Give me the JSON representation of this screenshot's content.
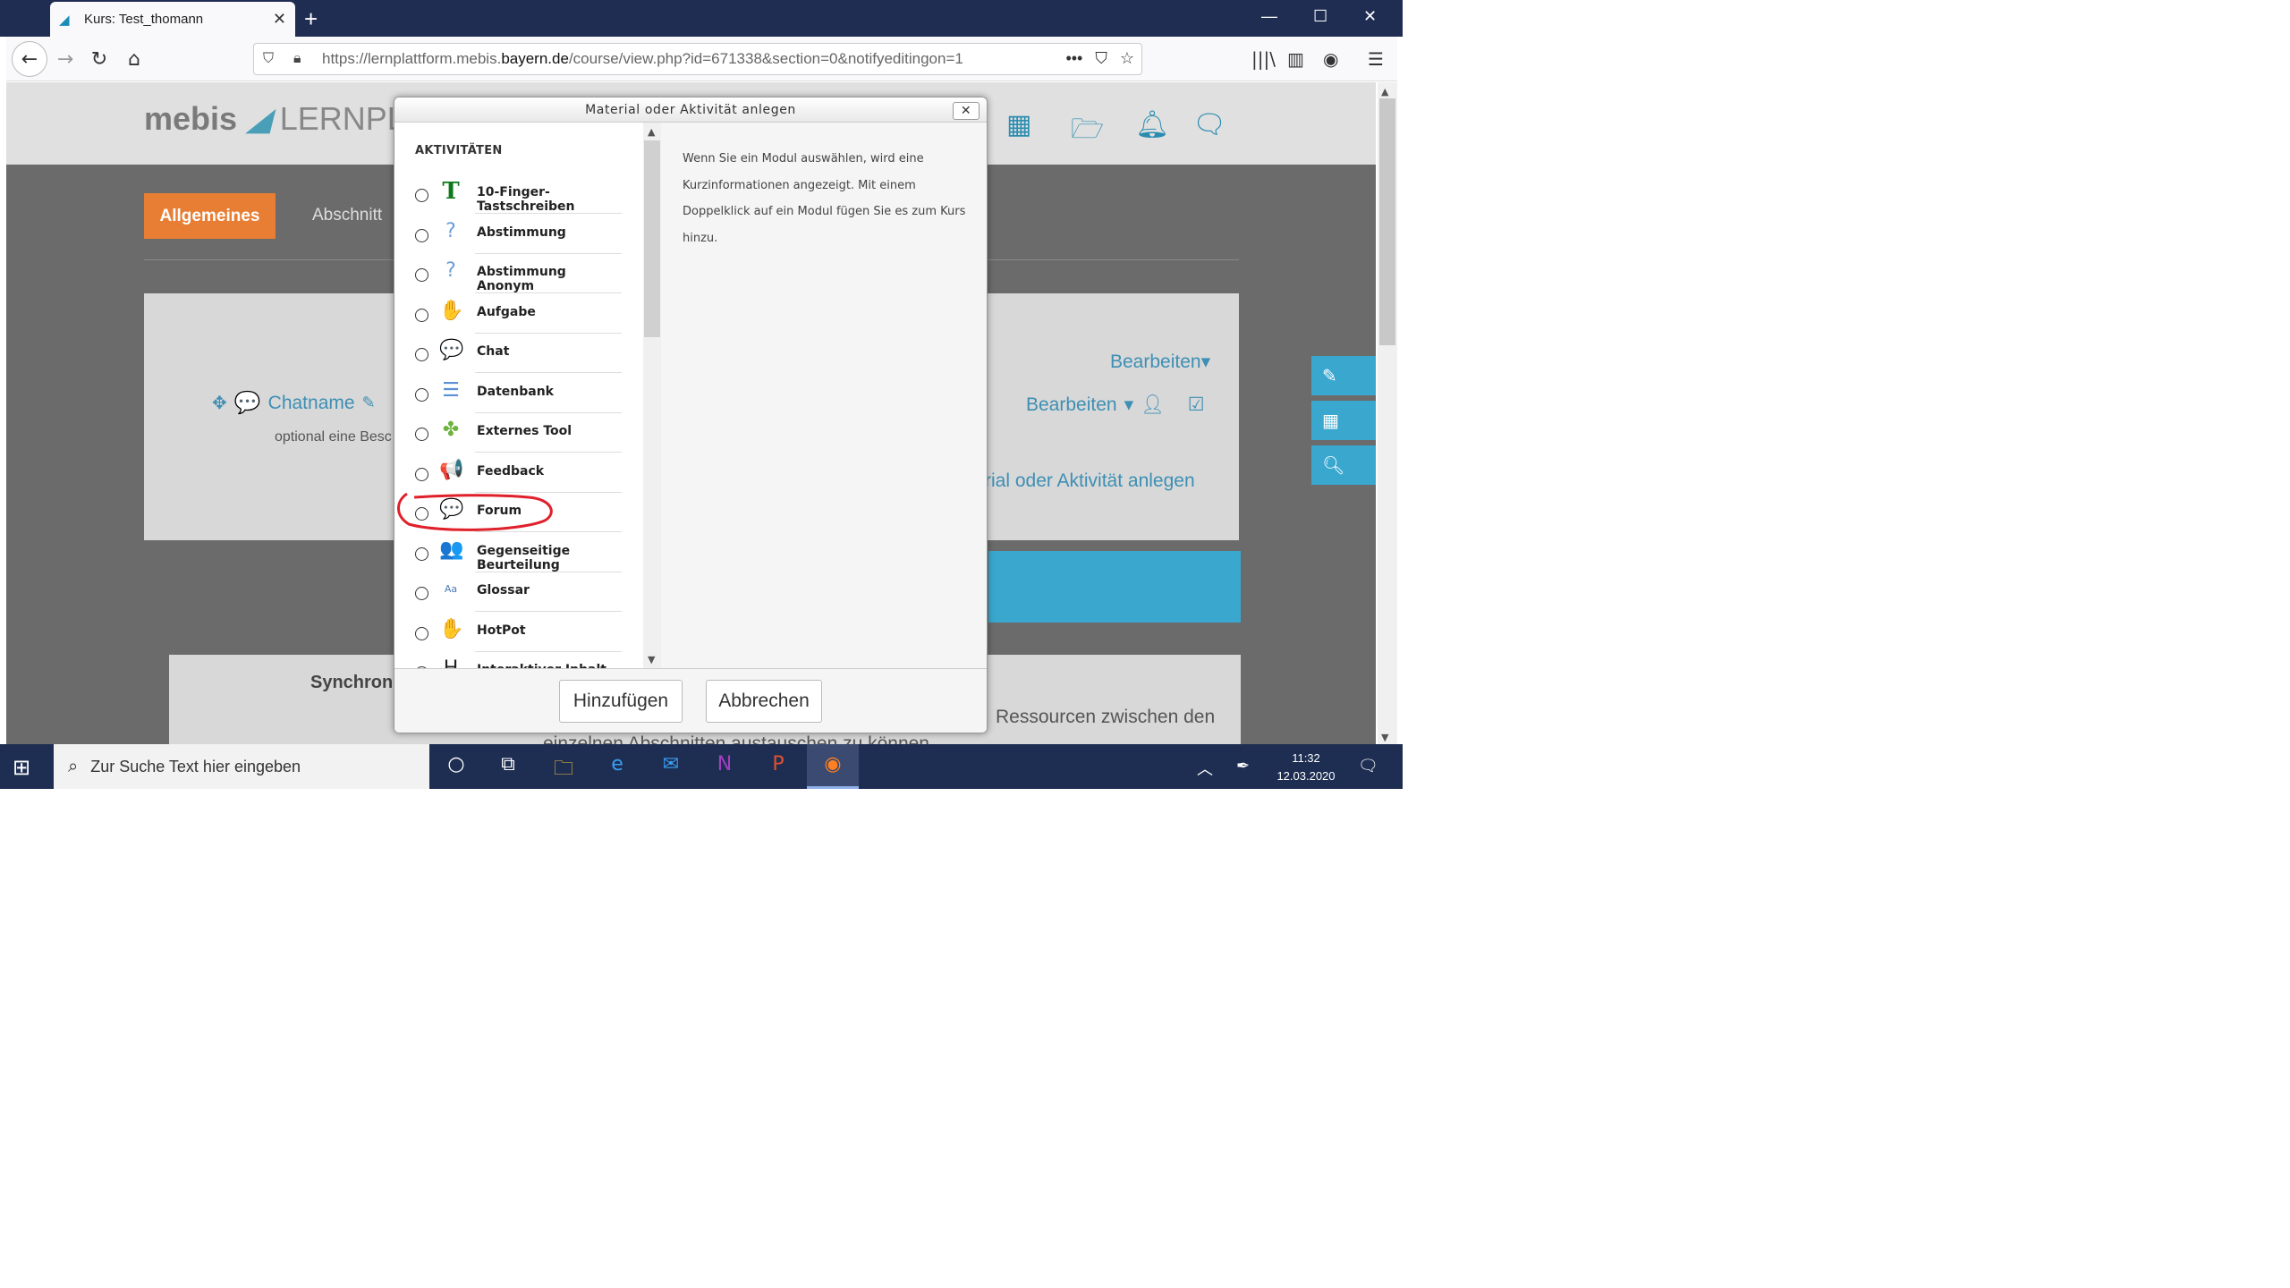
{
  "browser": {
    "tab_title": "Kurs: Test_thomann",
    "url_prefix": "https://lernplattform.mebis.",
    "url_domain": "bayern.de",
    "url_suffix": "/course/view.php?id=671338&section=0&notifyeditingon=1"
  },
  "page": {
    "logo_bold": "mebis",
    "logo_rest": "LERNPLA",
    "tab_active": "Allgemeines",
    "tab_other": "Abschnitt",
    "chat_link": "Chatname",
    "chat_desc": "optional eine Besc",
    "edit_label_1": "Bearbeiten",
    "edit_label_2": "Bearbeiten",
    "add_activity": "rial oder Aktivität anlegen",
    "sync_heading": "Synchron",
    "ress_text_1": "Ressourcen zwischen den",
    "ress_text_2": "einzelnen Abschnitten austauschen zu können"
  },
  "modal": {
    "title": "Material oder Aktivität anlegen",
    "close_label": "✕",
    "section_heading": "AKTIVITÄTEN",
    "items": [
      {
        "label": "10-Finger-Tastschreiben",
        "icon": "T",
        "color": "#0d7a1c"
      },
      {
        "label": "Abstimmung",
        "icon": "?",
        "color": "#6a9ed8"
      },
      {
        "label": "Abstimmung Anonym",
        "icon": "?",
        "color": "#6a9ed8"
      },
      {
        "label": "Aufgabe",
        "icon": "✋",
        "color": "#d8a070"
      },
      {
        "label": "Chat",
        "icon": "💬",
        "color": "#e0a32a"
      },
      {
        "label": "Datenbank",
        "icon": "☰",
        "color": "#5b8fd6"
      },
      {
        "label": "Externes Tool",
        "icon": "✤",
        "color": "#6db33f"
      },
      {
        "label": "Feedback",
        "icon": "📢",
        "color": "#e07020"
      },
      {
        "label": "Forum",
        "icon": "💬",
        "color": "#5aab48"
      },
      {
        "label": "Gegenseitige Beurteilung",
        "icon": "👥",
        "color": "#d08030"
      },
      {
        "label": "Glossar",
        "icon": "Aa",
        "color": "#4a7bb8"
      },
      {
        "label": "HotPot",
        "icon": "✋",
        "color": "#c06020"
      },
      {
        "label": "Interaktiver Inhalt",
        "icon": "H",
        "color": "#222222"
      }
    ],
    "description": "Wenn Sie ein Modul auswählen, wird eine Kurzinformationen angezeigt. Mit einem Doppelklick auf ein Modul fügen Sie es zum Kurs hinzu.",
    "add_button": "Hinzufügen",
    "cancel_button": "Abbrechen"
  },
  "taskbar": {
    "search_placeholder": "Zur Suche Text hier eingeben",
    "time": "11:32",
    "date": "12.03.2020"
  },
  "colors": {
    "accent_orange": "#e87e33",
    "accent_blue": "#3aa7cf",
    "link_blue": "#3d8fb4",
    "annotation_red": "#e0202a"
  }
}
